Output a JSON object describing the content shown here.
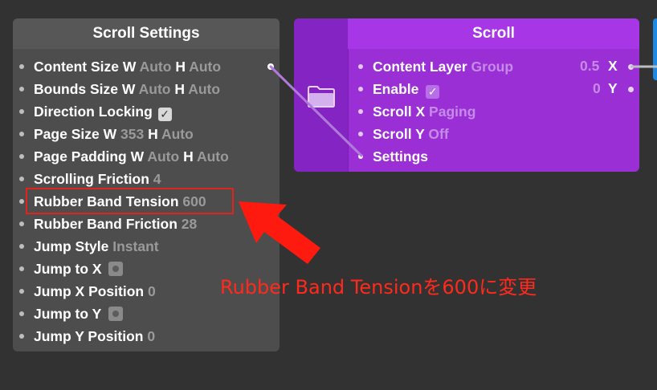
{
  "settings_panel": {
    "title": "Scroll Settings",
    "rows": [
      {
        "label": "Content Size",
        "parts": [
          "W",
          "Auto",
          "H",
          "Auto"
        ]
      },
      {
        "label": "Bounds Size",
        "parts": [
          "W",
          "Auto",
          "H",
          "Auto"
        ]
      },
      {
        "label": "Direction Locking",
        "checkbox": "✓"
      },
      {
        "label": "Page Size",
        "parts": [
          "W",
          "353",
          "H",
          "Auto"
        ]
      },
      {
        "label": "Page Padding",
        "parts": [
          "W",
          "Auto",
          "H",
          "Auto"
        ]
      },
      {
        "label": "Scrolling Friction",
        "value": "4"
      },
      {
        "label": "Rubber Band Tension",
        "value": "600"
      },
      {
        "label": "Rubber Band Friction",
        "value": "28"
      },
      {
        "label": "Jump Style",
        "value": "Instant"
      },
      {
        "label": "Jump to X"
      },
      {
        "label": "Jump X Position",
        "value": "0"
      },
      {
        "label": "Jump to Y"
      },
      {
        "label": "Jump Y Position",
        "value": "0"
      }
    ]
  },
  "scroll_node": {
    "title": "Scroll",
    "inputs": [
      {
        "label": "Content Layer",
        "value": "Group"
      },
      {
        "label": "Enable",
        "checkbox": "✓"
      },
      {
        "label": "Scroll X",
        "value": "Paging"
      },
      {
        "label": "Scroll Y",
        "value": "Off"
      },
      {
        "label": "Settings"
      }
    ],
    "outputs": [
      {
        "value": "0.5",
        "label": "X"
      },
      {
        "value": "0",
        "label": "Y"
      }
    ]
  },
  "annotation": {
    "text": "Rubber Band Tensionを600に変更",
    "color": "#ff2a1c"
  },
  "colors": {
    "background": "#323232",
    "settings_panel": "#4d4d4d",
    "scroll_node": "#9b2fd6",
    "highlight": "#e0231b",
    "blue_node_edge": "#1e88e5"
  },
  "icons": [
    "folder-icon",
    "checkbox-icon",
    "arrow-icon"
  ]
}
